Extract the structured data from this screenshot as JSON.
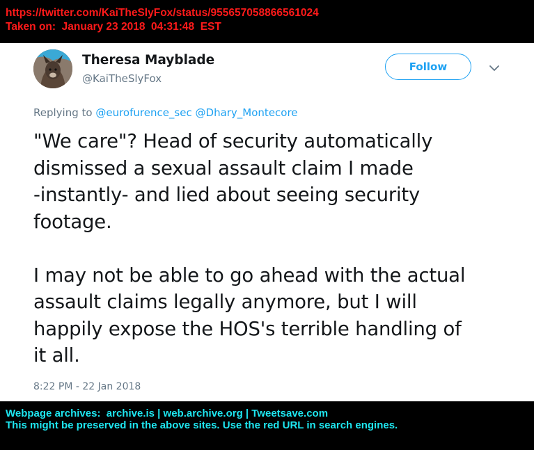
{
  "archive_header": {
    "url": "https://twitter.com/KaiTheSlyFox/status/955657058866561024",
    "taken_on": "Taken on:  January 23 2018  04:31:48  EST"
  },
  "tweet": {
    "author_name": "Theresa Mayblade",
    "author_handle": "@KaiTheSlyFox",
    "follow_label": "Follow",
    "reply_prefix": "Replying to ",
    "reply_mentions": [
      "@eurofurence_sec",
      "@Dhary_Montecore"
    ],
    "paragraphs": [
      "\"We care\"? Head of security automatically\ndismissed a sexual assault claim I made\n-instantly- and lied about seeing security\nfootage.",
      "I may not be able to go ahead with the actual\nassault claims legally anymore, but I will\nhappily expose the HOS's terrible handling of\nit all."
    ],
    "timestamp": "8:22 PM - 22 Jan 2018",
    "accent_color": "#1da1f2"
  },
  "archive_footer": {
    "line1": "Webpage archives:  archive.is | web.archive.org | Tweetsave.com",
    "line2": "This might be preserved in the above sites. Use the red URL in search engines."
  }
}
